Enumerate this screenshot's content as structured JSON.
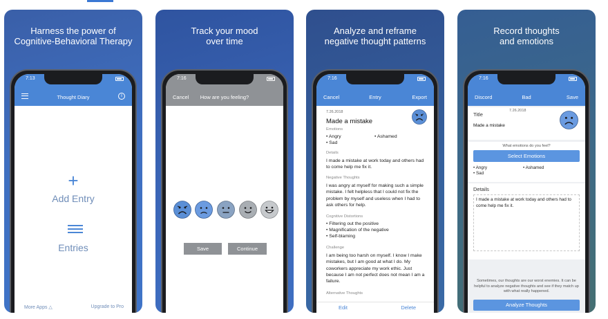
{
  "panels": [
    {
      "caption": [
        "Harness the power of",
        "Cognitive-Behavioral Therapy"
      ],
      "status_time": "7:13",
      "nav_title": "Thought Diary",
      "info_icon": "info-icon",
      "add_label": "Add Entry",
      "entries_label": "Entries",
      "footer_left": "More Apps",
      "footer_right": "Upgrade to Pro"
    },
    {
      "caption": [
        "Track your mood",
        "over time"
      ],
      "status_time": "7:16",
      "nav_left": "Cancel",
      "nav_title": "How are you feeling?",
      "moods": [
        "very-sad",
        "sad",
        "neutral",
        "happy",
        "very-happy"
      ],
      "mood_colors": [
        "#5b8fd6",
        "#6b9be0",
        "#8aa3c2",
        "#a9aeb3",
        "#c6c9cc"
      ],
      "save_label": "Save",
      "continue_label": "Continue"
    },
    {
      "caption": [
        "Analyze and reframe",
        "negative thought patterns"
      ],
      "status_time": "7:16",
      "nav_left": "Cancel",
      "nav_title": "Entry",
      "nav_right": "Export",
      "date": "7.26.2018",
      "title": "Made a mistake",
      "emotions_header": "Emotions",
      "emotions": [
        "• Angry",
        "• Sad",
        "• Ashamed"
      ],
      "details_header": "Details",
      "details": "I made a mistake at work today and others had to come help me fix it.",
      "negative_header": "Negative Thoughts",
      "negative": "I was angry at myself for making such a simple mistake. I felt helpless that I could not fix the problem by myself and useless when I had to ask others for help.",
      "distortions_header": "Cognitive Distortions",
      "distortions": [
        "• Filtering out the positive",
        "• Magnification of the negative",
        "• Self-blaming"
      ],
      "challenge_header": "Challenge",
      "challenge": "I am being too harsh on myself. I know I make mistakes, but I am good at what I do. My coworkers appreciate my work ethic. Just because I am not perfect does not mean I am a failure.",
      "alternative_header": "Alternative Thoughts",
      "edit_label": "Edit",
      "delete_label": "Delete"
    },
    {
      "caption": [
        "Record thoughts",
        "and emotions"
      ],
      "status_time": "7:16",
      "nav_left": "Discord",
      "nav_title": "Bad",
      "nav_right": "Save",
      "title_label": "Title",
      "date": "7.26.2018",
      "title_value": "Made a mistake",
      "emotions_question": "What emotions do you feel?",
      "select_label": "Select Emotions",
      "emotions": [
        "• Angry",
        "• Sad",
        "• Ashamed"
      ],
      "details_label": "Details",
      "details_value": "I made a mistake at work today and others had to come help me fix it.",
      "tip": "Sometimes, our thoughts are our worst enemies. It can be helpful to analyze negative thoughts and see if they match up with what really happened.",
      "analyze_label": "Analyze Thoughts"
    }
  ]
}
